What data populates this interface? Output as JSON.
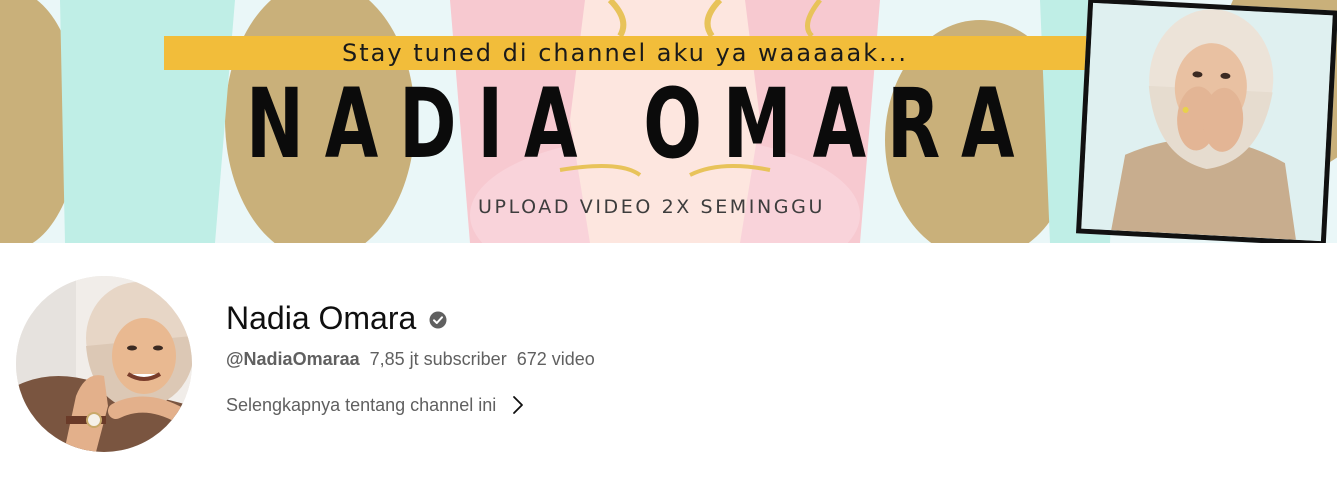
{
  "banner": {
    "tagline": "Stay tuned di channel aku ya waaaaak...",
    "title": "NADIA OMARA",
    "subtitle": "UPLOAD VIDEO 2X SEMINGGU"
  },
  "channel": {
    "name": "Nadia Omara",
    "handle": "@NadiaOmaraa",
    "subscribers": "7,85 jt subscriber",
    "videos": "672 video",
    "about_label": "Selengkapnya tentang channel ini"
  },
  "icons": {
    "verified": "verified-check-icon",
    "chevron": "chevron-right-icon"
  },
  "colors": {
    "banner_accent": "#f2bd3a",
    "banner_pink": "#f7c9d0",
    "banner_mint": "#bfeee6",
    "banner_olive": "#c9b07a",
    "text_primary": "#0f0f0f",
    "text_secondary": "#606060"
  }
}
